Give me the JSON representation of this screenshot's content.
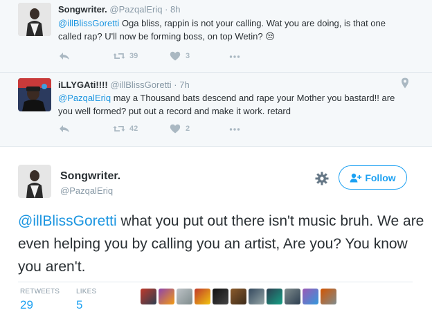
{
  "replies": [
    {
      "name": "Songwriter.",
      "meta": "@PazqalEriq · 8h",
      "mention": "@illBlissGoretti",
      "text": " Oga bliss, rappin is not your calling. Wat you are doing, is that one called rap? U'll now be forming boss, on top Wetin? 😒",
      "retweets": "39",
      "likes": "3"
    },
    {
      "name": "iLLYGAti!!!!",
      "meta": "@illBlissGoretti · 7h",
      "mention": "@PazqalEriq",
      "text": " may a Thousand bats descend and rape your Mother you bastard!! are you well formed? put out a record and make it work. retard",
      "retweets": "42",
      "likes": "2"
    }
  ],
  "main": {
    "name": "Songwriter.",
    "handle": "@PazqalEriq",
    "follow_label": "Follow",
    "mention": "@illBlissGoretti",
    "text": " what you put out there isn't music bruh. We are even helping you by calling you an artist, Are you? You know you aren't.",
    "stats": {
      "retweets_label": "RETWEETS",
      "retweets": "29",
      "likes_label": "LIKES",
      "likes": "5"
    }
  },
  "icons": {
    "reply": "reply-icon",
    "retweet": "retweet-icon",
    "like": "heart-icon",
    "more": "more-icon",
    "location": "location-pin-icon",
    "settings": "gear-icon",
    "follow": "follow-user-icon"
  },
  "colors": {
    "accent": "#1da1f2",
    "mention": "#1b95e0",
    "muted": "#8899a6",
    "icon": "#aab8c2",
    "reply_bg": "#f5f8fa"
  }
}
